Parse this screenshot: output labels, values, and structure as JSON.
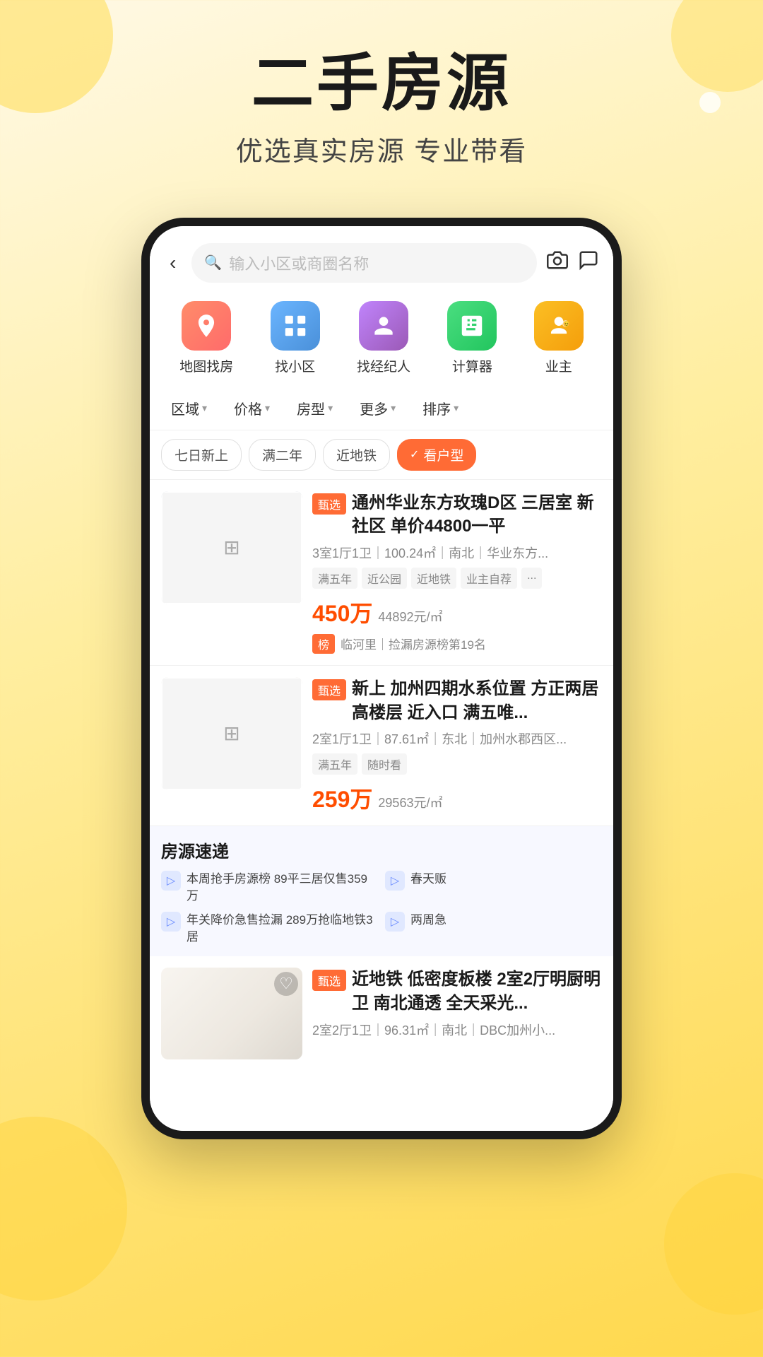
{
  "page": {
    "background": "gradient yellow",
    "title_main": "二手房源",
    "title_sub": "优选真实房源 专业带看"
  },
  "search_bar": {
    "back_label": "‹",
    "placeholder": "输入小区或商圈名称",
    "camera_icon": "camera",
    "message_icon": "message"
  },
  "quick_nav": {
    "items": [
      {
        "label": "地图找房",
        "icon_type": "map"
      },
      {
        "label": "找小区",
        "icon_type": "area"
      },
      {
        "label": "找经纪人",
        "icon_type": "agent"
      },
      {
        "label": "计算器",
        "icon_type": "calc"
      },
      {
        "label": "业主",
        "icon_type": "owner"
      }
    ]
  },
  "filters": {
    "tags": [
      {
        "label": "区域",
        "has_arrow": true
      },
      {
        "label": "价格",
        "has_arrow": true
      },
      {
        "label": "房型",
        "has_arrow": true
      },
      {
        "label": "更多",
        "has_arrow": true
      },
      {
        "label": "排序",
        "has_arrow": true
      }
    ]
  },
  "quick_pills": [
    {
      "label": "七日新上",
      "active": false
    },
    {
      "label": "满二年",
      "active": false
    },
    {
      "label": "近地铁",
      "active": false
    },
    {
      "label": "看户型",
      "active": true
    }
  ],
  "listings": [
    {
      "badge": "甄选",
      "title": "通州华业东方玫瑰D区 三居室 新社区 单价44800一平",
      "meta": "3室1厅1卫｜100.24㎡｜南北｜华业东方...",
      "tags": [
        "满五年",
        "近公园",
        "近地铁",
        "业主自荐",
        "..."
      ],
      "price": "450万",
      "price_per": "44892元/㎡",
      "rank_badge": "榜",
      "rank_text": "临河里｜捡漏房源榜第19名"
    },
    {
      "badge": "甄选",
      "title": "新上 加州四期水系位置 方正两居 高楼层 近入口 满五唯...",
      "meta": "2室1厅1卫｜87.61㎡｜东北｜加州水郡西区...",
      "tags": [
        "满五年",
        "随时看"
      ],
      "price": "259万",
      "price_per": "29563元/㎡",
      "rank_badge": "",
      "rank_text": ""
    }
  ],
  "express": {
    "title": "房源速递",
    "items": [
      {
        "text": "本周抢手房源榜 89平三居仅售359万"
      },
      {
        "text": "春天贩"
      },
      {
        "text": "年关降价急售捡漏 289万抢临地铁3居"
      },
      {
        "text": "两周急"
      }
    ]
  },
  "third_listing": {
    "badge": "甄选",
    "title": "近地铁 低密度板楼 2室2厅明厨明卫 南北通透 全天采光...",
    "meta": "2室2厅1卫｜96.31㎡｜南北｜DBC加州小..."
  }
}
